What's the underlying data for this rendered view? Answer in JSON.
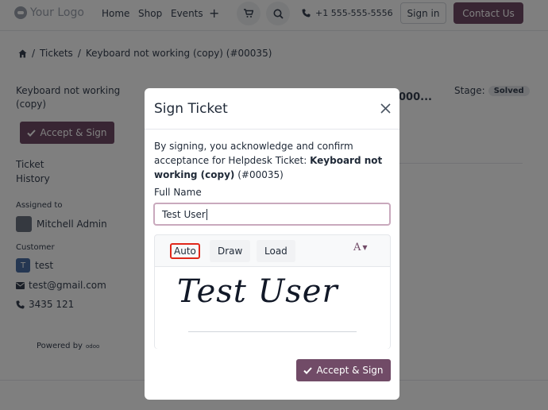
{
  "nav": {
    "logo_text": "Your Logo",
    "links": [
      "Home",
      "Shop",
      "Events"
    ],
    "plus": "+",
    "phone": "+1 555-555-5556",
    "signin_label": "Sign in",
    "contact_label": "Contact Us",
    "icons": {
      "cart": "cart-icon",
      "search": "search-icon",
      "phone": "phone-icon"
    }
  },
  "breadcrumb": {
    "home_icon": "home-icon",
    "separator": "/",
    "items": [
      "Tickets",
      "Keyboard not working (copy) (#00035)"
    ]
  },
  "sidebar": {
    "ticket_title": "Keyboard not working (copy)",
    "accept_label": "Accept & Sign",
    "links": [
      "Ticket",
      "History"
    ],
    "assigned_label": "Assigned to",
    "assigned_name": "Mitchell Admin",
    "customer_label": "Customer",
    "customer_initial": "T",
    "customer_name": "test",
    "email": "test@gmail.com",
    "phone": "3435 121",
    "powered_by": "Powered by",
    "powered_brand": "odoo"
  },
  "main": {
    "title_fragment": "000...",
    "stage_label": "Stage:",
    "stage_value": "Solved"
  },
  "modal": {
    "title": "Sign Ticket",
    "close_icon": "close-icon",
    "intro_prefix": "By signing, you acknowledge and confirm acceptance for Helpdesk Ticket:",
    "intro_bold": "Keyboard not working (copy)",
    "intro_suffix": "(#00035)",
    "fullname_label": "Full Name",
    "fullname_value": "Test User",
    "tabs": [
      "Auto",
      "Draw",
      "Load"
    ],
    "active_tab": "Auto",
    "font_icon": "A",
    "signature_text": "Test User",
    "accept_label": "Accept & Sign"
  },
  "colors": {
    "brand": "#714b67",
    "active_tab_border": "#e0281b",
    "input_focus": "#c9a9bd"
  }
}
